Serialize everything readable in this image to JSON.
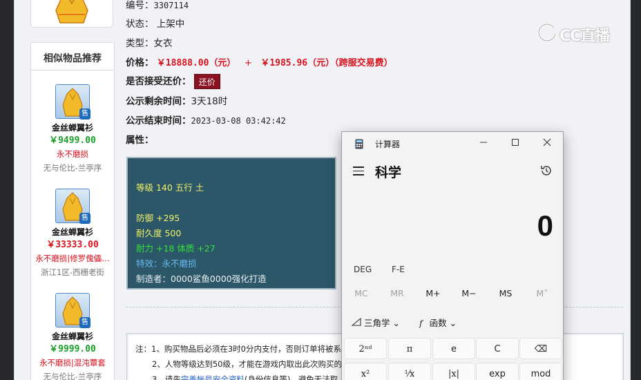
{
  "listing": {
    "number_label": "编号：",
    "number_value": "3307114",
    "status_label": "状态：",
    "status_value": "上架中",
    "type_label": "类型：",
    "type_value": "女衣",
    "price_label": "价格：",
    "price_value": "￥18888.00（元）",
    "price_plus": "+",
    "fee_value": "￥1985.96（元）（跨服交易费）",
    "counter_label": "是否接受还价：",
    "counter_button": "还价",
    "remaining_label": "公示剩余时间：",
    "remaining_value": "3天18时",
    "end_label": "公示结束时间：",
    "end_value": "2023-03-08 03:42:42",
    "attr_label": "属性："
  },
  "attributes": {
    "level_line": "等级 140 五行 土",
    "defense": "防御 +295",
    "durability": "耐久度 500",
    "stats": "耐力 +18 体质 +27",
    "effect": "特效：永不磨损",
    "maker": "制造者：0000鲨鱼0000强化打造"
  },
  "similar": {
    "title": "相似物品推荐",
    "sale_badge": "售",
    "items": [
      {
        "name": "金丝蝉翼衫",
        "price": "￥9499.00",
        "tag": "永不磨损",
        "server": "无与伦比-兰亭序"
      },
      {
        "name": "金丝蝉翼衫",
        "price": "￥33333.00",
        "tag": "永不磨损|修罗傀儡…",
        "server": "浙江1区-西栅老街"
      },
      {
        "name": "金丝蝉翼衫",
        "price": "￥9999.00",
        "tag": "永不磨损|混沌蕈套",
        "server": "无与伦比-兰亭序"
      }
    ]
  },
  "notes": {
    "line1": "注：1、购买物品后必须在3时0分内支付，否则订单将被系",
    "line2": "2、人物等级达到50级，才能在游戏内取出此次购买的",
    "line3_pre": "3、请先",
    "line3_link": "完善帐号安全资料",
    "line3_post": "(身份信息等)，避免无法取"
  },
  "watermark": {
    "text": "CC直播"
  },
  "calculator": {
    "window_title": "计算器",
    "mode": "科学",
    "display": "0",
    "deg": "DEG",
    "fe": "F-E",
    "memory": [
      "MC",
      "MR",
      "M+",
      "M−",
      "MS",
      "M˅"
    ],
    "trig": "三角学",
    "func": "函数",
    "keys_row1": [
      "2ⁿᵈ",
      "π",
      "e",
      "C",
      "⌫"
    ],
    "keys_row2": [
      "x²",
      "¹⁄x",
      "|x|",
      "exp",
      "mod"
    ]
  }
}
